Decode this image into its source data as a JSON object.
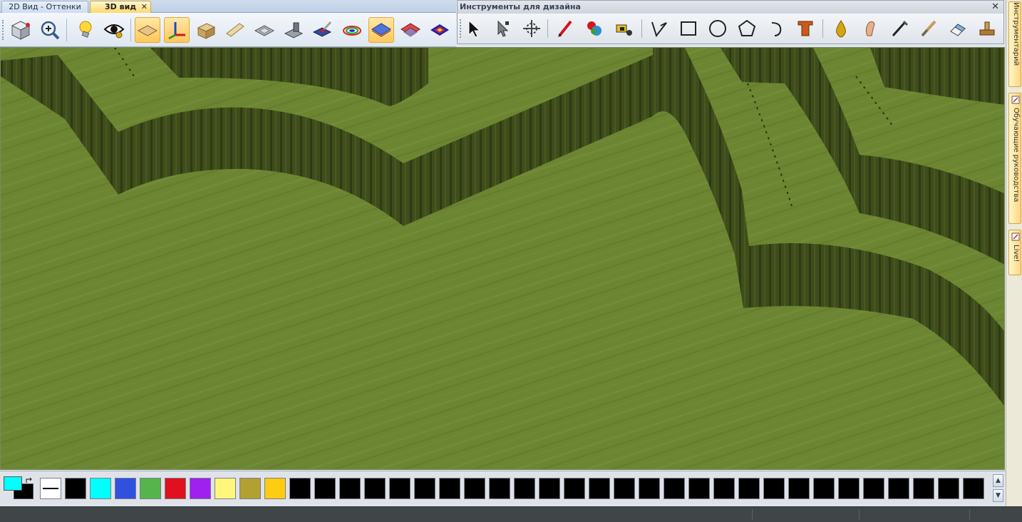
{
  "tabs": [
    {
      "label": "2D Вид - Оттенки",
      "active": false
    },
    {
      "label": "3D вид",
      "active": true
    }
  ],
  "tab_close_glyph": "✕",
  "toolbar3d": {
    "buttons": [
      {
        "icon": "cube-view-icon",
        "active": false
      },
      {
        "icon": "zoom-icon",
        "active": false
      },
      {
        "icon": "light-bulb-icon",
        "active": false
      },
      {
        "icon": "eye-icon",
        "active": false
      },
      {
        "icon": "flat-plane-icon",
        "active": true
      },
      {
        "icon": "axes-icon",
        "active": true
      },
      {
        "icon": "wood-box-icon",
        "active": false
      },
      {
        "icon": "wood-plank-icon",
        "active": false
      },
      {
        "icon": "relief-plate-icon",
        "active": false
      },
      {
        "icon": "machine-icon",
        "active": false
      },
      {
        "icon": "paint-brush-icon",
        "active": false
      },
      {
        "icon": "color-layer-icon",
        "active": false
      },
      {
        "icon": "blue-plane-icon",
        "active": true
      },
      {
        "icon": "red-plane-icon",
        "active": false
      },
      {
        "icon": "heatmap-plane-icon",
        "active": false
      }
    ]
  },
  "design_tools": {
    "title": "Инструменты для дизайна",
    "close_glyph": "✕",
    "buttons": [
      "select-arrow-icon",
      "node-edit-icon",
      "transform-icon",
      "pencil-icon",
      "color-fill-icon",
      "eraser-fill-icon",
      "polyline-icon",
      "rectangle-icon",
      "circle-icon",
      "polygon-icon",
      "arc-icon",
      "text-icon",
      "drop-icon",
      "smudge-icon",
      "pen-icon",
      "knife-icon",
      "eraser-icon",
      "stamp-icon"
    ]
  },
  "side_tabs": [
    {
      "label": "Инструментарий"
    },
    {
      "label": "Обучающие руководства"
    },
    {
      "label": "Live!"
    }
  ],
  "palette": {
    "primary_color": "#00ffff",
    "secondary_color": "#000000",
    "swatches": [
      "#ffffff",
      "#000000",
      "#00ffff",
      "#3050e0",
      "#55b44c",
      "#e0101e",
      "#a020f0",
      "#fff67a",
      "#b2a032",
      "#ffcc10",
      "#000000",
      "#000000",
      "#000000",
      "#000000",
      "#000000",
      "#000000",
      "#000000",
      "#000000",
      "#000000",
      "#000000",
      "#000000",
      "#000000",
      "#000000",
      "#000000",
      "#000000",
      "#000000",
      "#000000",
      "#000000",
      "#000000",
      "#000000",
      "#000000",
      "#000000",
      "#000000",
      "#000000",
      "#000000",
      "#000000",
      "#000000",
      "#000000"
    ],
    "scroll_up": "▲",
    "scroll_down": "▼"
  },
  "colors": {
    "terrain_top": "#6b842f",
    "terrain_wall": "#3d4a1a",
    "terrain_wall_dark": "#2e3811"
  }
}
